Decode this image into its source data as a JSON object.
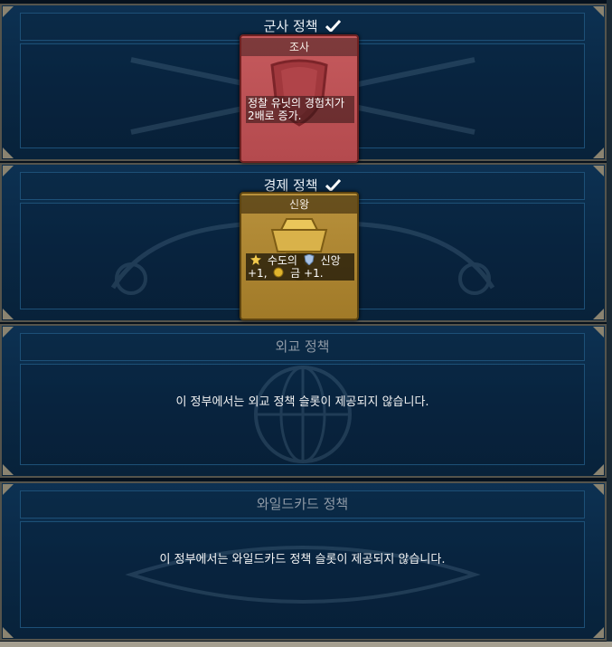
{
  "colors": {
    "panel_bg": "#0b2b4a",
    "panel_border": "#1d5077",
    "military_card": "#c0585c",
    "economic_card": "#b08a36",
    "check": "#ffffff"
  },
  "panels": {
    "military": {
      "title": "군사 정책",
      "adopted_icon": "check-icon",
      "card": {
        "title": "조사",
        "icon": "shield-icon",
        "description": "정찰 유닛의 경험치가 2배로 증가."
      }
    },
    "economic": {
      "title": "경제 정책",
      "adopted_icon": "check-icon",
      "card": {
        "title": "신왕",
        "icon": "crown-icon",
        "desc_part1": "수도의",
        "desc_faith_icon": "faith-icon",
        "desc_part2": "신앙",
        "desc_part3": "+1,",
        "desc_gold_icon": "gold-icon",
        "desc_part4": "금 +1.",
        "desc_star_icon": "star-icon"
      }
    },
    "diplomatic": {
      "title": "외교 정책",
      "message": "이 정부에서는 외교 정책 슬롯이 제공되지 않습니다."
    },
    "wildcard": {
      "title": "와일드카드 정책",
      "message": "이 정부에서는 와일드카드 정책 슬롯이 제공되지 않습니다."
    }
  }
}
